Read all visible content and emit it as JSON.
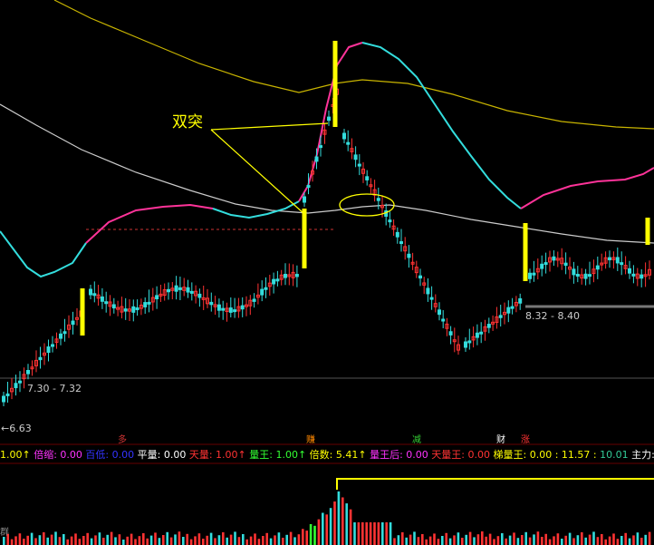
{
  "annotation": {
    "text": "双突"
  },
  "price_labels": {
    "left_range": "7.30 - 7.32",
    "right_range": "8.32 - 8.40",
    "low_marker": "←6.63"
  },
  "signal_markers": [
    {
      "text": "多",
      "color": "#cc3333"
    },
    {
      "text": "赚",
      "color": "#ff8800"
    },
    {
      "text": "减",
      "color": "#33cc33"
    },
    {
      "text": "财",
      "color": "#ffffff"
    },
    {
      "text": "涨",
      "color": "#ff3333"
    }
  ],
  "indicator_bar": [
    {
      "text": "1.00↑",
      "color": "#ffff00"
    },
    {
      "text": "倍缩: 0.00",
      "color": "#ff33ff"
    },
    {
      "text": "百低: 0.00",
      "color": "#3333ff"
    },
    {
      "text": "平量: 0.00",
      "color": "#ffffff"
    },
    {
      "text": "天量: 1.00↑",
      "color": "#ff3333"
    },
    {
      "text": "量王: 1.00↑",
      "color": "#33ff33"
    },
    {
      "text": "倍数: 5.41↑",
      "color": "#ffff00"
    },
    {
      "text": "量王后: 0.00",
      "color": "#ff33ff"
    },
    {
      "text": "天量王: 0.00",
      "color": "#ff3333"
    },
    {
      "text": "梯量王: 0.00 : 11.57 : ",
      "color": "#ffff00"
    },
    {
      "text": "10.01",
      "color": "#33cc99"
    },
    {
      "text": "主力:",
      "color": "#ffffff"
    }
  ],
  "volume_panel": {
    "side_label": "群"
  },
  "chart_data": {
    "type": "candlestick",
    "title": "",
    "series": [
      {
        "name": "",
        "color": "#33dddd",
        "role": "short moving average (cyan/magenta)"
      },
      {
        "name": "",
        "color": "#c8b400",
        "role": "long moving average (olive)"
      },
      {
        "name": "",
        "color": "#cccccc",
        "role": "medium moving average (grey)"
      }
    ],
    "price_levels": [
      6.63,
      7.3,
      7.32,
      8.32,
      8.4
    ],
    "colors": {
      "up_candle": "#ff3333",
      "down_candle": "#33dddd",
      "signal_bar": "#ffff00",
      "ma_rising": "#ff3399",
      "ma_falling": "#33dddd",
      "long_ma": "#c8b400",
      "mid_ma": "#cccccc",
      "annotation": "#ffff00"
    }
  }
}
